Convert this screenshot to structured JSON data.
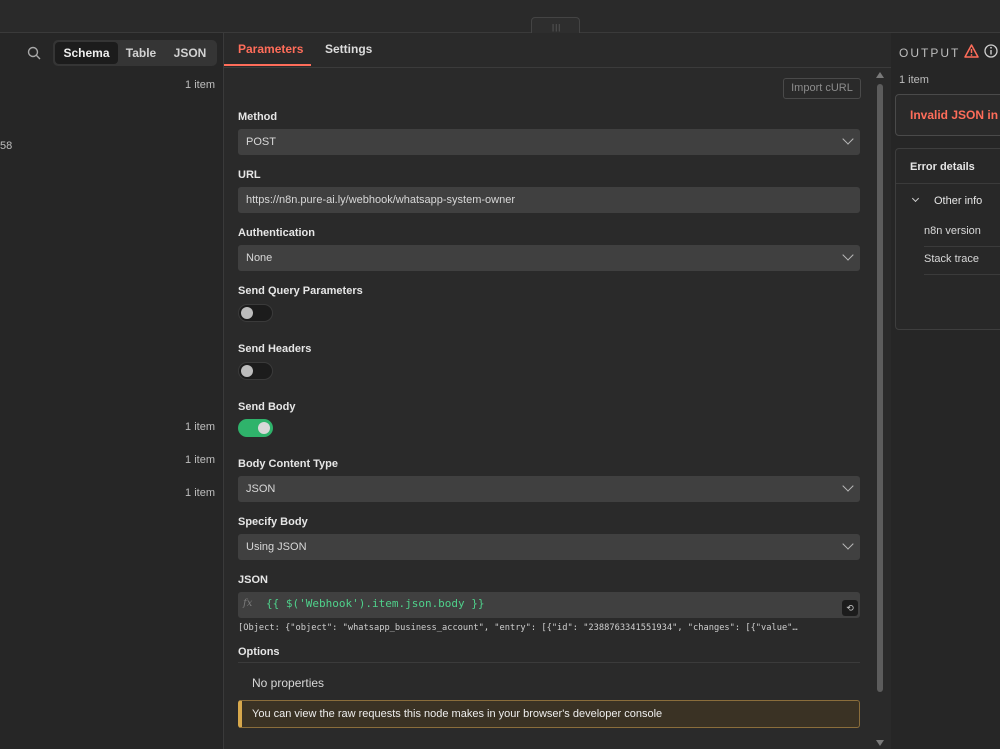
{
  "left_panel": {
    "view_tabs": [
      "Schema",
      "Table",
      "JSON"
    ],
    "item_labels": [
      "1 item",
      "1 item",
      "1 item",
      "1 item"
    ],
    "partial_value": "58"
  },
  "center_panel": {
    "tabs": [
      "Parameters",
      "Settings"
    ],
    "import_button": "Import cURL",
    "method": {
      "label": "Method",
      "value": "POST"
    },
    "url": {
      "label": "URL",
      "value": "https://n8n.pure-ai.ly/webhook/whatsapp-system-owner"
    },
    "authentication": {
      "label": "Authentication",
      "value": "None"
    },
    "send_query": {
      "label": "Send Query Parameters",
      "enabled": false
    },
    "send_headers": {
      "label": "Send Headers",
      "enabled": false
    },
    "send_body": {
      "label": "Send Body",
      "enabled": true
    },
    "body_content_type": {
      "label": "Body Content Type",
      "value": "JSON"
    },
    "specify_body": {
      "label": "Specify Body",
      "value": "Using JSON"
    },
    "json": {
      "label": "JSON",
      "fx_icon": "fx",
      "expression": "{{ $('Webhook').item.json.body }}",
      "preview": "[Object: {\"object\": \"whatsapp_business_account\", \"entry\": [{\"id\": \"2388763341551934\", \"changes\": [{\"value\"…"
    },
    "options": {
      "label": "Options",
      "empty_text": "No properties"
    },
    "notice": "You can view the raw requests this node makes in your browser's developer console"
  },
  "output_panel": {
    "title": "OUTPUT",
    "count": "1 item",
    "error_message": "Invalid JSON in",
    "error_details": {
      "title": "Error details",
      "section": "Other info",
      "rows": [
        "n8n version",
        "Stack trace"
      ]
    }
  },
  "colors": {
    "accent": "#ff6d5a",
    "toggle_on": "#2fb36b",
    "expression": "#4fd18b",
    "warning": "#d7a84c"
  }
}
